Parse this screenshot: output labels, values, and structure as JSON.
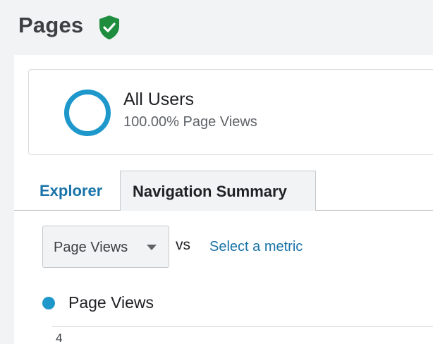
{
  "header": {
    "title": "Pages",
    "verified_icon": "verified-shield-check-icon",
    "verified_color": "#1e8e3e"
  },
  "segment": {
    "name": "All Users",
    "subtitle": "100.00% Page Views",
    "ring_color": "#1e98cb"
  },
  "tabs": [
    {
      "label": "Explorer",
      "active": false
    },
    {
      "label": "Navigation Summary",
      "active": true
    }
  ],
  "metric_selector": {
    "selected": "Page Views",
    "vs_label": "vs",
    "secondary_link": "Select a metric"
  },
  "chart": {
    "legend_label": "Page Views",
    "legend_color": "#1e98cb",
    "y_tick": "4"
  }
}
